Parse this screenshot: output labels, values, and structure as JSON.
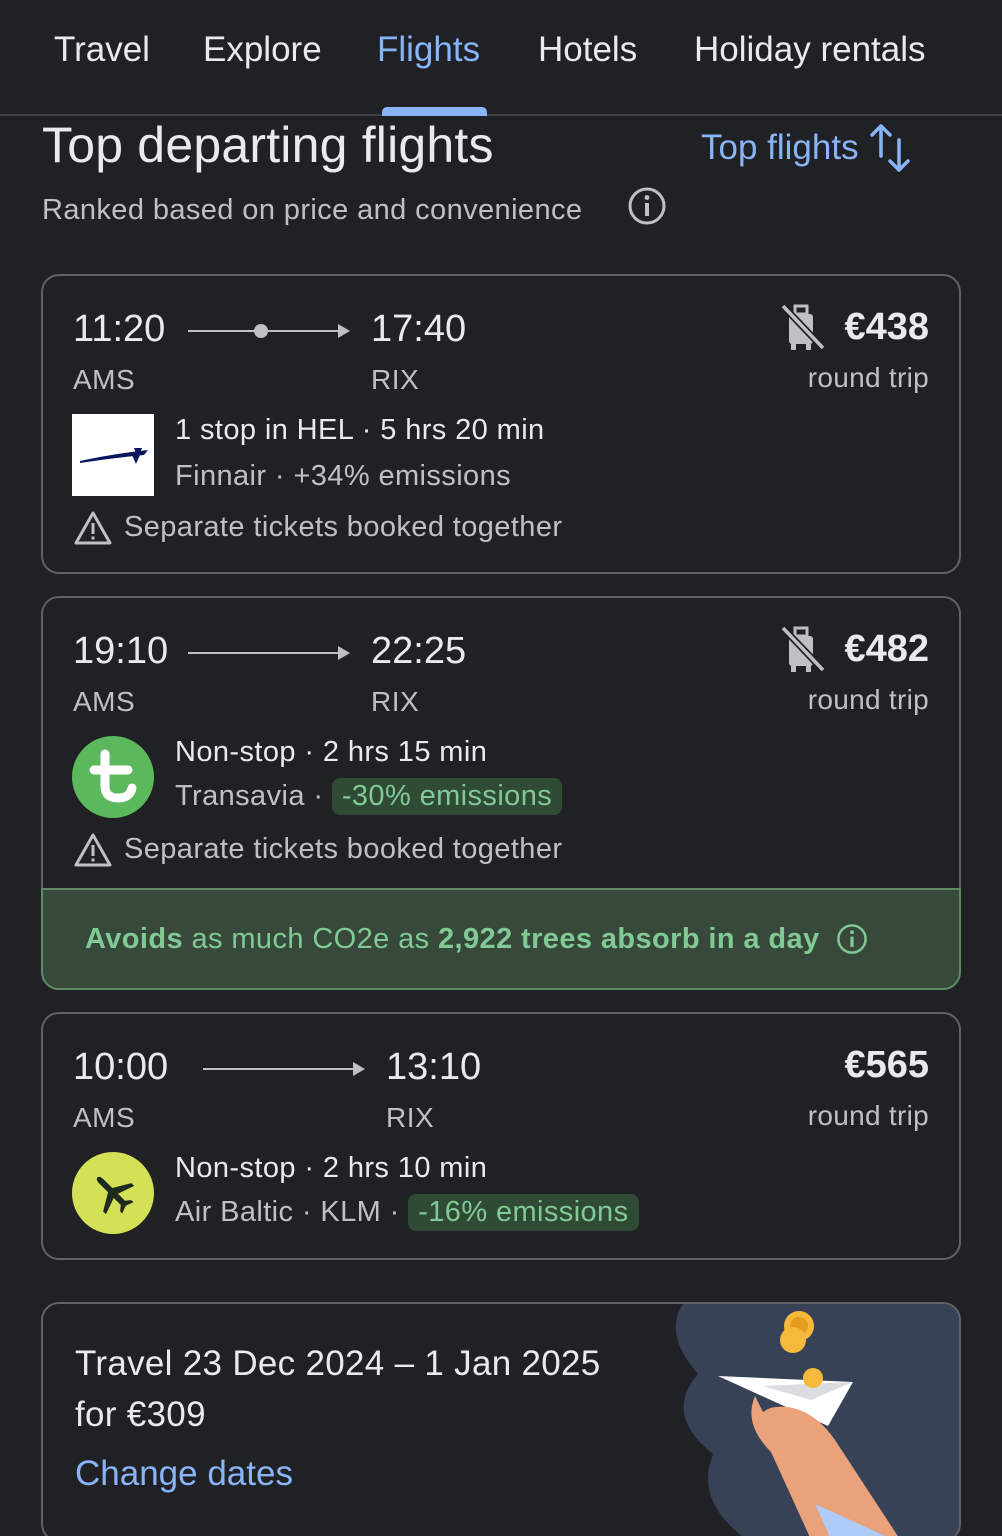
{
  "tabs": [
    {
      "label": "Travel",
      "active": false
    },
    {
      "label": "Explore",
      "active": false
    },
    {
      "label": "Flights",
      "active": true
    },
    {
      "label": "Hotels",
      "active": false
    },
    {
      "label": "Holiday rentals",
      "active": false
    }
  ],
  "header": {
    "title": "Top departing flights",
    "subtitle": "Ranked based on price and convenience",
    "sort_label": "Top flights"
  },
  "flights": [
    {
      "depart_time": "11:20",
      "arrive_time": "17:40",
      "from": "AMS",
      "to": "RIX",
      "price": "€438",
      "price_note": "round trip",
      "no_carry_on": true,
      "stops": "1 stop in HEL",
      "duration": "5 hrs 20 min",
      "airlines": "Finnair",
      "emissions": "+34% emissions",
      "warning": "Separate tickets booked together"
    },
    {
      "depart_time": "19:10",
      "arrive_time": "22:25",
      "from": "AMS",
      "to": "RIX",
      "price": "€482",
      "price_note": "round trip",
      "no_carry_on": true,
      "stops": "Non-stop",
      "duration": "2 hrs 15 min",
      "airlines": "Transavia",
      "emissions": "-30% emissions",
      "warning": "Separate tickets booked together",
      "eco": {
        "lead": "Avoids",
        "middle": " as much CO2e as ",
        "highlight": "2,922 trees absorb in a day"
      }
    },
    {
      "depart_time": "10:00",
      "arrive_time": "13:10",
      "from": "AMS",
      "to": "RIX",
      "price": "€565",
      "price_note": "round trip",
      "no_carry_on": false,
      "stops": "Non-stop",
      "duration": "2 hrs 10 min",
      "airlines": "Air Baltic · KLM",
      "emissions": "-16% emissions"
    }
  ],
  "promo": {
    "line1": "Travel 23 Dec 2024 – 1 Jan 2025",
    "line2": "for €309",
    "link": "Change dates"
  },
  "colors": {
    "background": "#202124",
    "accent": "#8ab4f8",
    "eco_green": "#81c995",
    "transavia_green": "#5cb85c",
    "airbaltic_yellow": "#d4e157",
    "finnair_blue": "#0b1560"
  },
  "icons": [
    "info-icon",
    "sort-arrows-icon",
    "no-bag-icon",
    "warning-icon",
    "plane-icon"
  ]
}
